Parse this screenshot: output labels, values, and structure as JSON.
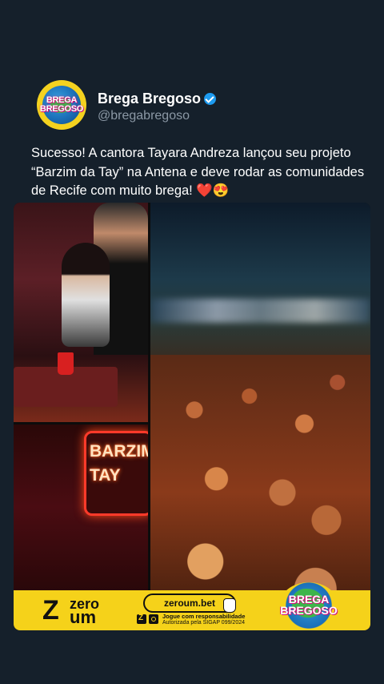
{
  "account": {
    "name": "Brega Bregoso",
    "handle": "@bregabregoso",
    "avatar_text_1": "BREGA",
    "avatar_text_2": "BREGOSO"
  },
  "post": {
    "text": "Sucesso! A cantora Tayara Andreza lançou seu projeto “Barzim da Tay” na Antena e deve rodar as comunidades de Recife com muito brega! ❤️😍"
  },
  "media": {
    "neon_sign_line_1": "BARZIM",
    "neon_sign_line_2": "TAY"
  },
  "banner": {
    "brand_z": "Z",
    "brand_word_1": "zero",
    "brand_word_2": "um",
    "site": "zeroum.bet",
    "responsibility": "Jogue com responsabilidade",
    "authorization": "Autorizada pela SIGAP 099/2024",
    "logo_text_1": "BREGA",
    "logo_text_2": "BREGOSO",
    "accent_color": "#f5d21a"
  },
  "colors": {
    "background": "#15202b",
    "handle": "#8b98a5",
    "verified": "#1d9bf0"
  }
}
